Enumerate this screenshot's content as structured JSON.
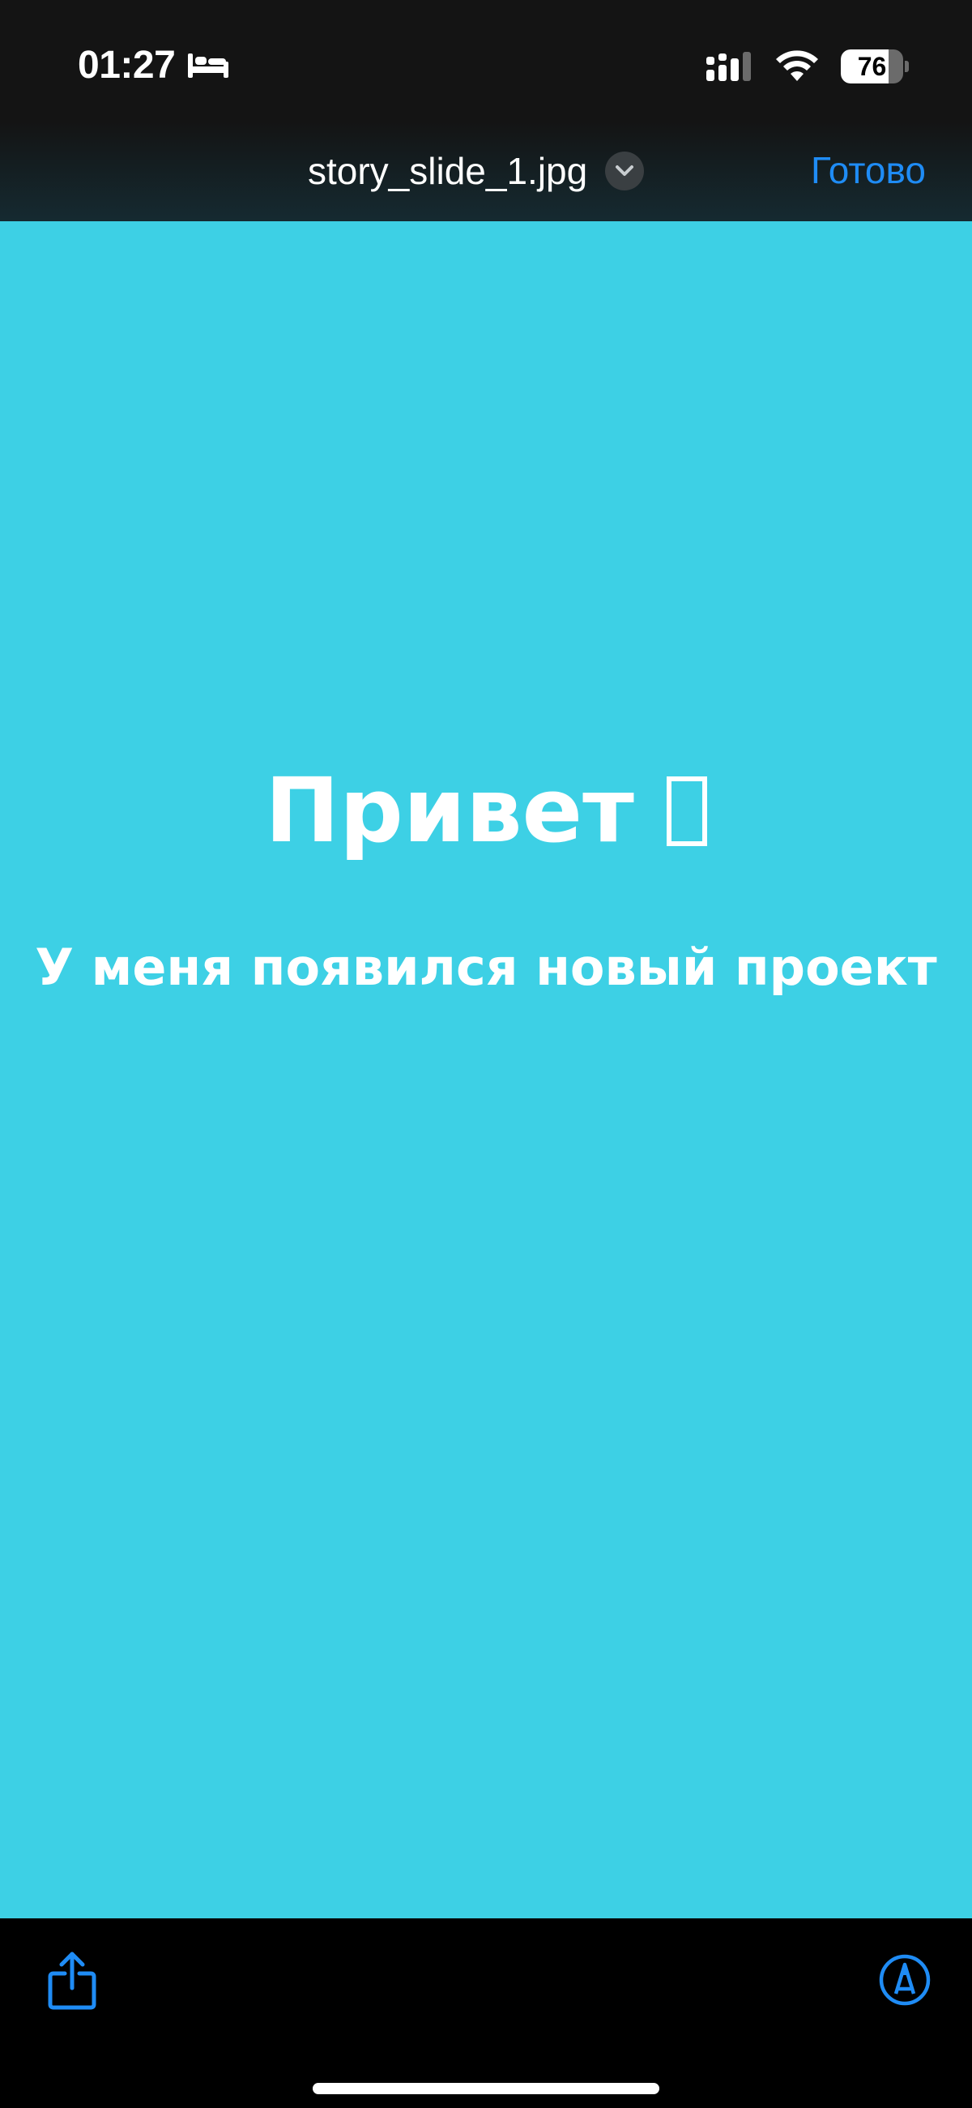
{
  "status_bar": {
    "time": "01:27",
    "focus_icon": "bed-icon",
    "signal_icon": "cellular-signal-icon",
    "wifi_icon": "wifi-icon",
    "battery_level": "76",
    "battery_fraction": 0.76
  },
  "nav_bar": {
    "file_name": "story_slide_1.jpg",
    "menu_icon": "chevron-down-icon",
    "done_label": "Готово",
    "accent_color": "#1f8cf5"
  },
  "preview": {
    "background_color": "#3dd0e5",
    "heading": "Привет",
    "subheading": "У меня появился новый проект"
  },
  "toolbar": {
    "share_icon": "share-icon",
    "markup_icon": "markup-pen-icon"
  }
}
